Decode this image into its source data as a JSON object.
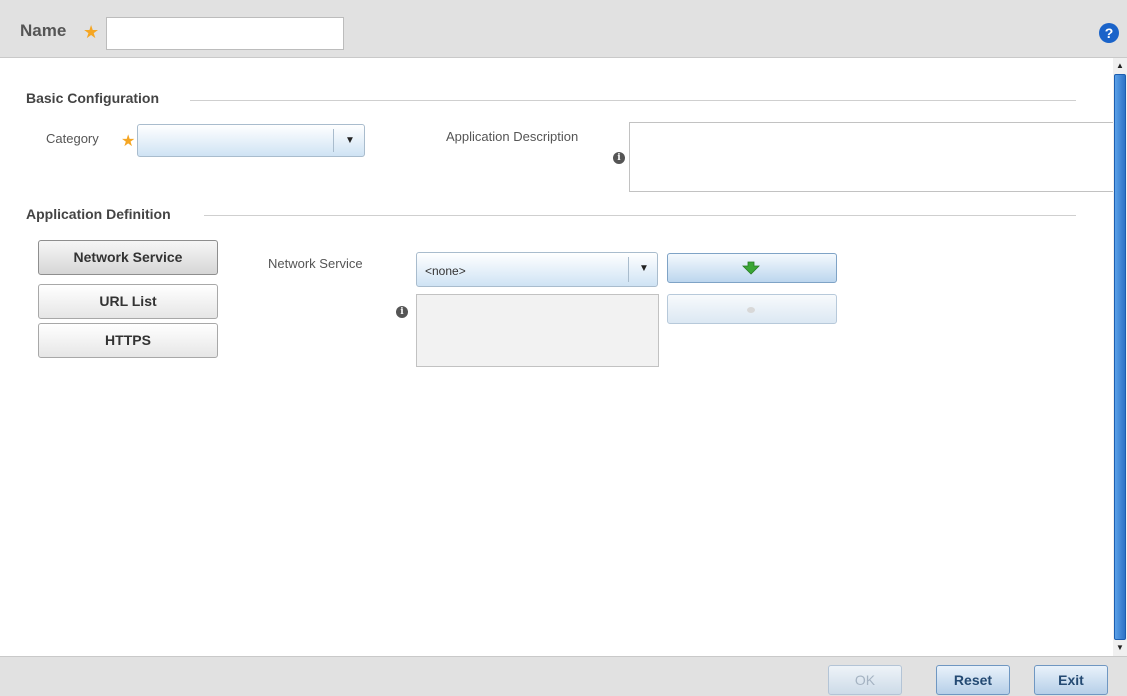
{
  "header": {
    "name_label": "Name",
    "required_mark": "★",
    "name_value": "",
    "help_label": "?"
  },
  "basic_config": {
    "title": "Basic Configuration",
    "category_label": "Category",
    "category_value": "",
    "app_description_label": "Application Description",
    "app_description_value": ""
  },
  "app_definition": {
    "title": "Application Definition",
    "tabs": [
      {
        "label": "Network Service",
        "active": true
      },
      {
        "label": "URL List",
        "active": false
      },
      {
        "label": "HTTPS",
        "active": false
      }
    ],
    "network_service_label": "Network Service",
    "network_service_value": "<none>",
    "network_service_list": ""
  },
  "icons": {
    "info": "i",
    "dropdown": "▼",
    "scroll_up": "▲",
    "scroll_down": "▼"
  },
  "footer": {
    "ok_label": "OK",
    "reset_label": "Reset",
    "exit_label": "Exit"
  },
  "colors": {
    "accent": "#1a63c9",
    "required": "#f5a623",
    "add_arrow": "#3aa635"
  }
}
